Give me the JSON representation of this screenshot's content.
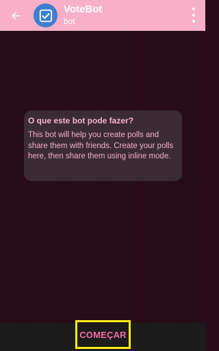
{
  "header": {
    "title": "VoteBot",
    "subtitle": "bot",
    "back_icon": "arrow-left-icon",
    "avatar_icon": "checkbox-check-icon",
    "menu_icon": "more-vert-icon"
  },
  "card": {
    "title": "O que este bot pode fazer?",
    "body": "This bot will help you create polls and share them with friends. Create your polls here, then share them using inline mode."
  },
  "bottom": {
    "start_label": "COMEÇAR"
  },
  "colors": {
    "header_bg": "#f7b0c8",
    "avatar_bg": "#3e7fd0",
    "chat_bg": "#2a0d1a",
    "card_bg": "#3b2b35",
    "accent_pink": "#f46ba3",
    "highlight_yellow": "#fff015"
  }
}
